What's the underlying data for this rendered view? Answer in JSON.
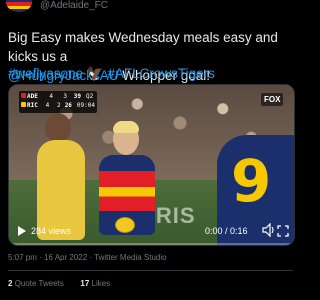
{
  "author": {
    "handle": "@Adelaide_FC"
  },
  "tweet": {
    "text_before": "Big Easy makes Wednesday meals easy and kicks us a",
    "mention": "@HungryJacksAU",
    "text_after": " Whopper goal!",
    "hashtags": "#weflyasone",
    "hashtag_emoji": "🦅",
    "hashtag2": "#AFLCrowsTigers"
  },
  "video": {
    "scorebug": {
      "rows": [
        {
          "team": "ADE",
          "goals": "4",
          "behinds": "3",
          "total": "39",
          "time": "Q2"
        },
        {
          "team": "RIC",
          "goals": "4",
          "behinds": "2",
          "total": "26",
          "time": "09:04"
        }
      ]
    },
    "broadcaster": "FOX",
    "banner_text": "ARIS",
    "jersey_number": "9",
    "views": "284 views",
    "timer": "0:00 / 0:16",
    "progress": 0
  },
  "meta": {
    "timestamp": "5:07 pm · 16 Apr 2022 · Twitter Media Studio"
  },
  "stats": {
    "quote_count": "2",
    "quote_label": "Quote Tweets",
    "like_count": "17",
    "like_label": "Likes"
  }
}
